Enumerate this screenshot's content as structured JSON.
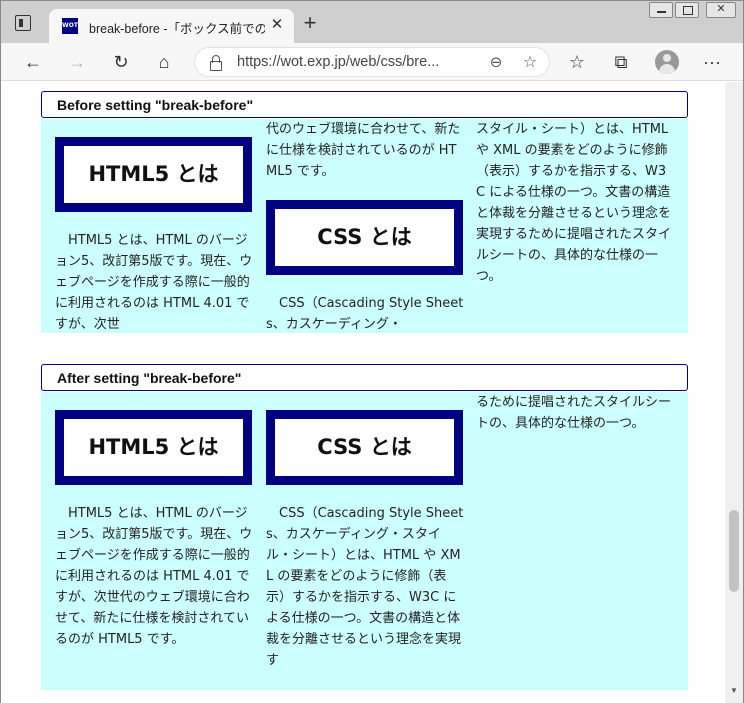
{
  "browser": {
    "tab_title": "break-before -「ボックス前でのカラム」",
    "favicon_text": "WOT",
    "tab_close": "✕",
    "new_tab": "+",
    "url": "https://wot.exp.jp/web/css/bre...",
    "buttons": {
      "back": "←",
      "forward": "→",
      "refresh": "↻",
      "home": "⌂",
      "favorites": "☆",
      "collections": "⧉",
      "more": "···",
      "zoom": "⊖",
      "add_favorite": "☆"
    }
  },
  "sections": {
    "before": {
      "heading": "Before setting \"break-before\"",
      "html5_box": "HTML5 とは",
      "css_box": "CSS とは",
      "col1_text": "　HTML5 とは、HTML のバージョン5、改訂第5版です。現在、ウェブページを作成する際に一般的に利用されるのは HTML 4.01 ですが、次世",
      "col2_top_text": "代のウェブ環境に合わせて、新たに仕様を検討されているのが HTML5 です。",
      "col2_bottom_text": "　CSS（Cascading Style Sheets、カスケーディング・",
      "col3_text": "スタイル・シート）とは、HTML や XML の要素をどのように修飾（表示）するかを指示する、W3C による仕様の一つ。文書の構造と体裁を分離させるという理念を実現するために提唱されたスタイルシートの、具体的な仕様の一つ。"
    },
    "after": {
      "heading": "After setting \"break-before\"",
      "html5_box": "HTML5 とは",
      "css_box": "CSS とは",
      "col1_text": "　HTML5 とは、HTML のバージョン5、改訂第5版です。現在、ウェブページを作成する際に一般的に利用されるのは HTML 4.01 ですが、次世代のウェブ環境に合わせて、新たに仕様を検討されているのが HTML5 です。",
      "col2_text": "　CSS（Cascading Style Sheets、カスケーディング・スタイル・シート）とは、HTML や XML の要素をどのように修飾（表示）するかを指示する、W3C による仕様の一つ。文書の構造と体裁を分離させるという理念を実現す",
      "col3_text": "るために提唱されたスタイルシートの、具体的な仕様の一つ。"
    }
  },
  "colors": {
    "box_border": "#000080",
    "demo_background": "#ccffff",
    "heading_border": "#000080"
  }
}
